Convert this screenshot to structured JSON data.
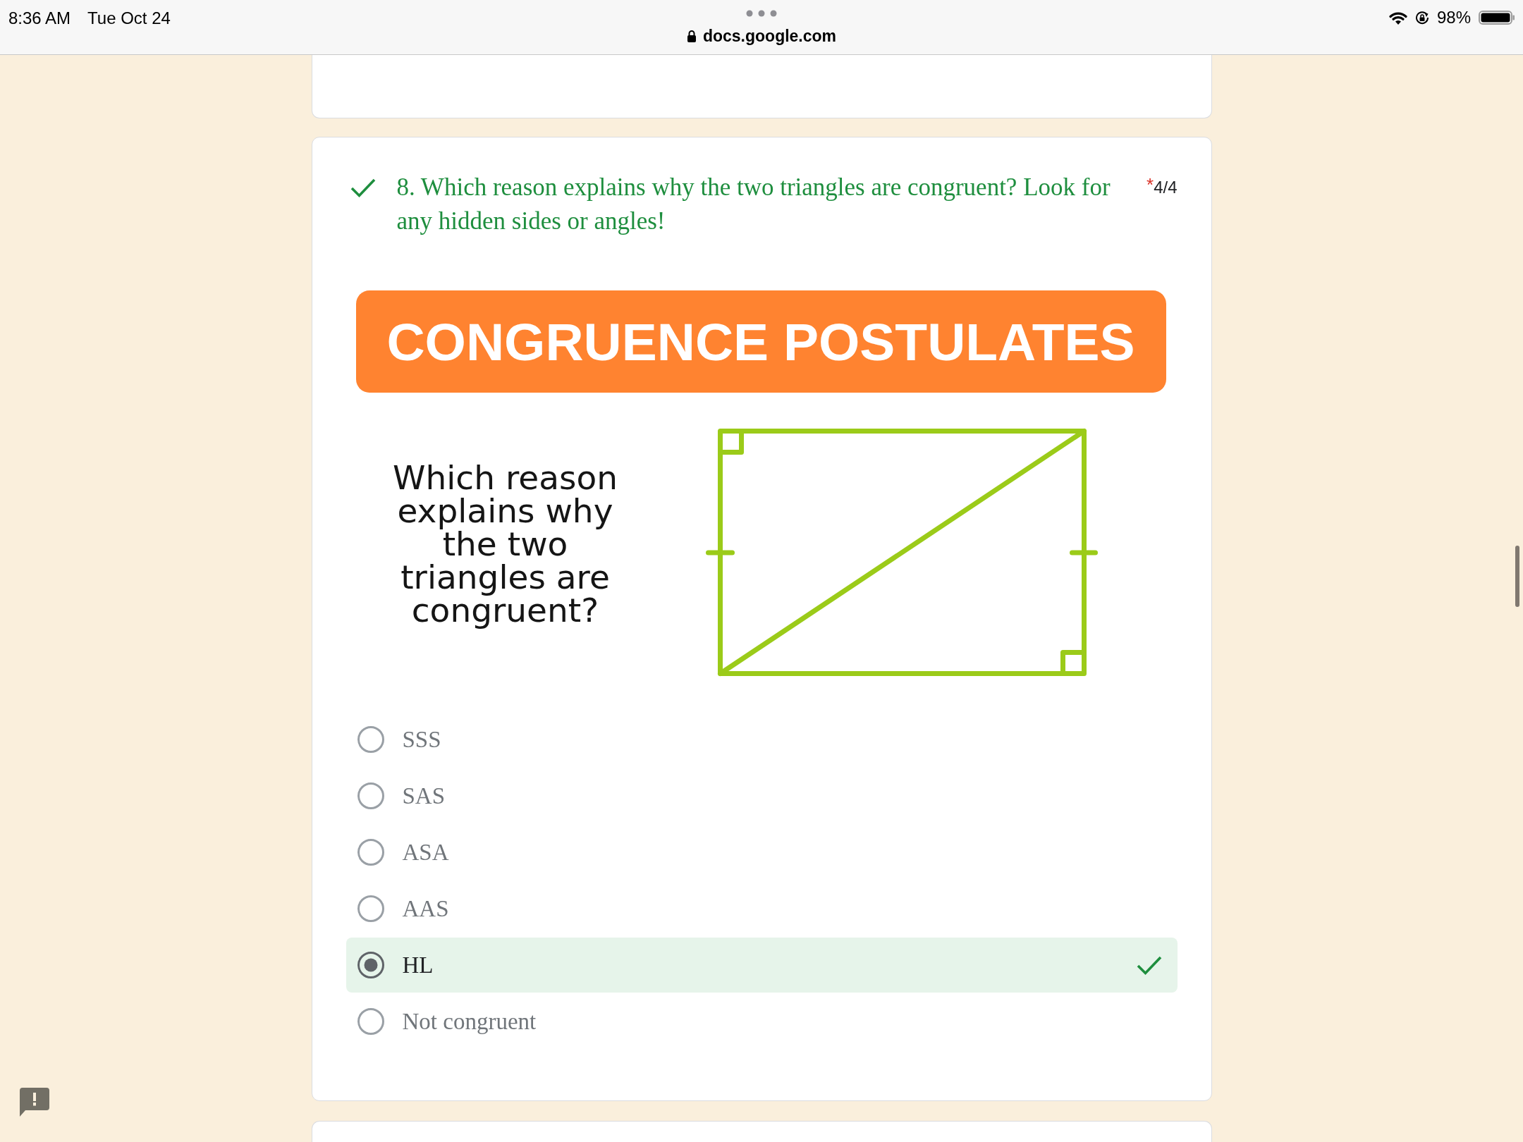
{
  "status_bar": {
    "time": "8:36 AM",
    "date": "Tue Oct 24",
    "url": "docs.google.com",
    "battery_percent": "98%"
  },
  "question": {
    "correct": true,
    "title": "8. Which reason explains why the two triangles are congruent? Look for any hidden sides or angles!",
    "required_mark": "*",
    "score": "4/4",
    "image": {
      "banner": "CONGRUENCE POSTULATES",
      "caption": "Which reason explains why the two triangles are congruent?"
    },
    "options": [
      {
        "label": "SSS",
        "selected": false,
        "correct": false
      },
      {
        "label": "SAS",
        "selected": false,
        "correct": false
      },
      {
        "label": "ASA",
        "selected": false,
        "correct": false
      },
      {
        "label": "AAS",
        "selected": false,
        "correct": false
      },
      {
        "label": "HL",
        "selected": true,
        "correct": true
      },
      {
        "label": "Not congruent",
        "selected": false,
        "correct": false
      }
    ]
  }
}
